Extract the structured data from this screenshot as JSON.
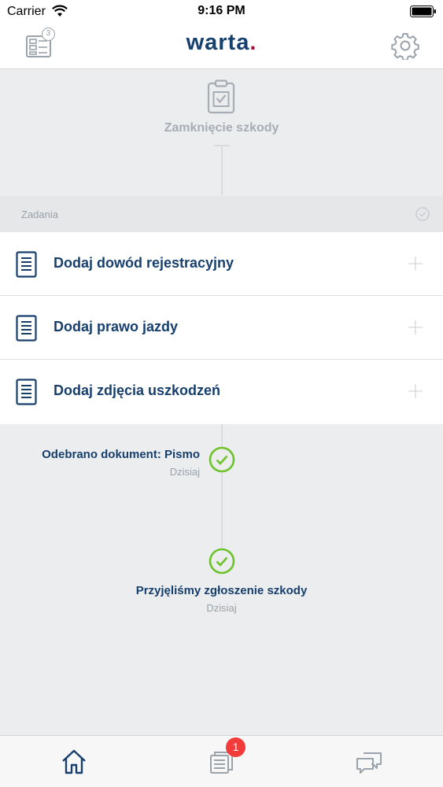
{
  "status_bar": {
    "carrier": "Carrier",
    "time": "9:16 PM"
  },
  "header": {
    "logo_text": "warta",
    "logo_dot": ".",
    "claims_count": "3",
    "brand_color": "#16406d",
    "accent_color": "#a6113c"
  },
  "step": {
    "title": "Zamknięcie szkody",
    "icon": "clipboard-check-icon"
  },
  "tasks": {
    "header_label": "Zadania",
    "items": [
      {
        "label": "Dodaj dowód rejestracyjny",
        "icon": "document-icon"
      },
      {
        "label": "Dodaj prawo jazdy",
        "icon": "document-icon"
      },
      {
        "label": "Dodaj zdjęcia uszkodzeń",
        "icon": "document-icon"
      }
    ]
  },
  "timeline": [
    {
      "title": "Odebrano dokument: Pismo",
      "date": "Dzisiaj",
      "status": "done",
      "color": "#6cc229"
    },
    {
      "title": "Przyjęliśmy zgłoszenie szkody",
      "date": "Dzisiaj",
      "status": "done",
      "color": "#6cc229"
    }
  ],
  "bottom_nav": {
    "items": [
      {
        "icon": "home-icon"
      },
      {
        "icon": "documents-icon"
      },
      {
        "icon": "chat-icon"
      }
    ],
    "documents_badge": "1"
  }
}
